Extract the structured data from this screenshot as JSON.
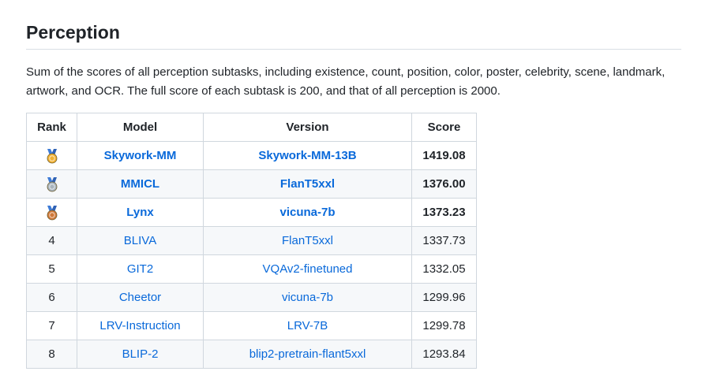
{
  "section": {
    "title": "Perception",
    "description": "Sum of the scores of all perception subtasks, including existence, count, position, color, poster, celebrity, scene, landmark, artwork, and OCR. The full score of each subtask is 200, and that of all perception is 2000."
  },
  "table": {
    "headers": [
      "Rank",
      "Model",
      "Version",
      "Score"
    ],
    "rows": [
      {
        "rank": "",
        "medal": "gold-medal-icon",
        "model": "Skywork-MM",
        "version": "Skywork-MM-13B",
        "score": "1419.08",
        "bold": true
      },
      {
        "rank": "",
        "medal": "silver-medal-icon",
        "model": "MMICL",
        "version": "FlanT5xxl",
        "score": "1376.00",
        "bold": true
      },
      {
        "rank": "",
        "medal": "bronze-medal-icon",
        "model": "Lynx",
        "version": "vicuna-7b",
        "score": "1373.23",
        "bold": true
      },
      {
        "rank": "4",
        "medal": "",
        "model": "BLIVA",
        "version": "FlanT5xxl",
        "score": "1337.73",
        "bold": false
      },
      {
        "rank": "5",
        "medal": "",
        "model": "GIT2",
        "version": "VQAv2-finetuned",
        "score": "1332.05",
        "bold": false
      },
      {
        "rank": "6",
        "medal": "",
        "model": "Cheetor",
        "version": "vicuna-7b",
        "score": "1299.96",
        "bold": false
      },
      {
        "rank": "7",
        "medal": "",
        "model": "LRV-Instruction",
        "version": "LRV-7B",
        "score": "1299.78",
        "bold": false
      },
      {
        "rank": "8",
        "medal": "",
        "model": "BLIP-2",
        "version": "blip2-pretrain-flant5xxl",
        "score": "1293.84",
        "bold": false
      }
    ]
  },
  "colors": {
    "link": "#0969da",
    "gold": "#f2b233",
    "silver": "#a8b4bd",
    "bronze": "#d07a3a",
    "ribbon": "#3d7bd6"
  }
}
